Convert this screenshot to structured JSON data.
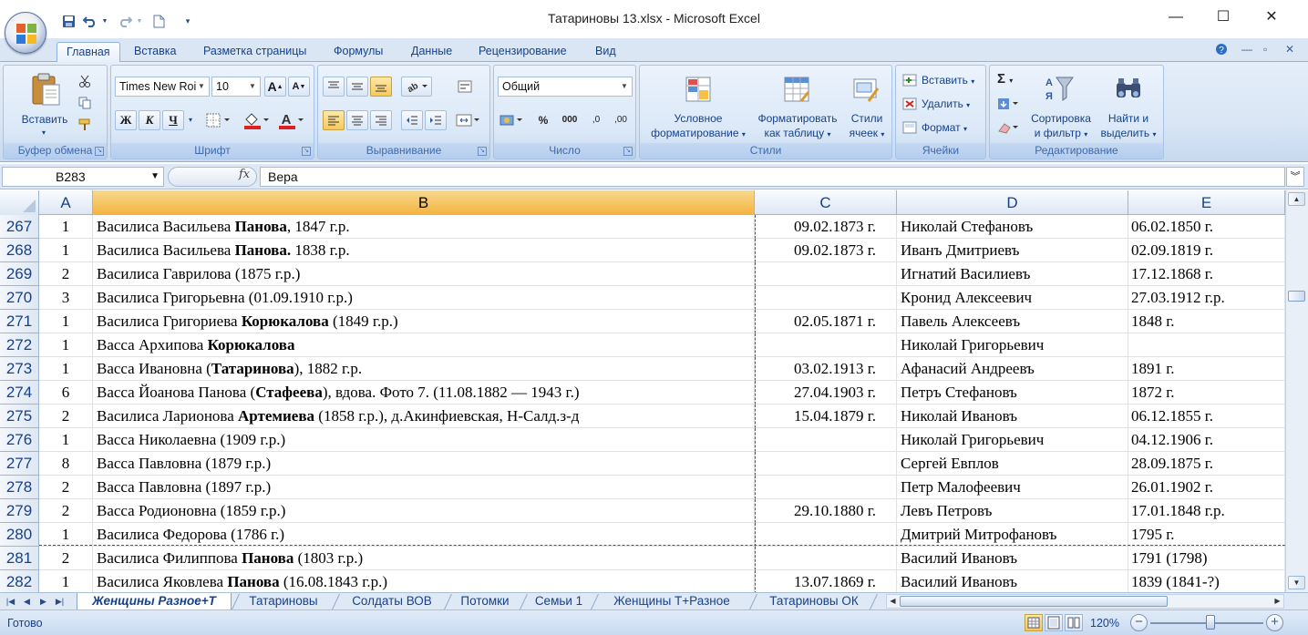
{
  "window": {
    "title": "Татариновы 13.xlsx - Microsoft Excel",
    "minimize": "—",
    "maximize": "☐",
    "close": "✕"
  },
  "qat": {
    "save_icon": "save-icon",
    "undo_icon": "undo-icon",
    "redo_icon": "redo-icon",
    "new_icon": "new-document-icon",
    "customize_icon": "customize-icon"
  },
  "ribbon_tabs": [
    {
      "label": "Главная",
      "active": true
    },
    {
      "label": "Вставка"
    },
    {
      "label": "Разметка страницы"
    },
    {
      "label": "Формулы"
    },
    {
      "label": "Данные"
    },
    {
      "label": "Рецензирование"
    },
    {
      "label": "Вид"
    }
  ],
  "ribbon": {
    "clipboard": {
      "label": "Буфер обмена",
      "paste": "Вставить"
    },
    "font": {
      "label": "Шрифт",
      "font_name": "Times New Roi",
      "font_size": "10",
      "bold": "Ж",
      "italic": "К",
      "underline": "Ч",
      "grow": "A",
      "shrink": "A"
    },
    "alignment": {
      "label": "Выравнивание"
    },
    "number": {
      "label": "Число",
      "format": "Общий",
      "percent": "%",
      "thousands": "000",
      "inc_dec": ",0",
      "dec_dec": ",00"
    },
    "styles": {
      "label": "Стили",
      "cond_format_1": "Условное",
      "cond_format_2": "форматирование",
      "format_table_1": "Форматировать",
      "format_table_2": "как таблицу",
      "cell_styles_1": "Стили",
      "cell_styles_2": "ячеек"
    },
    "cells": {
      "label": "Ячейки",
      "insert": "Вставить",
      "delete": "Удалить",
      "format": "Формат"
    },
    "editing": {
      "label": "Редактирование",
      "sum": "Σ",
      "sort_1": "Сортировка",
      "sort_2": "и фильтр",
      "find_1": "Найти и",
      "find_2": "выделить"
    }
  },
  "formula_bar": {
    "name_box": "B283",
    "fx": "fx",
    "value": "Вера"
  },
  "columns": [
    "A",
    "B",
    "C",
    "D",
    "E"
  ],
  "selected_column": "B",
  "rows": [
    {
      "n": "267",
      "a": "1",
      "b_pre": "Василиса Васильева ",
      "b_bold": "Панова",
      "b_post": ", 1847 г.р.",
      "c": "09.02.1873 г.",
      "d": "Николай Стефановъ",
      "e": "06.02.1850 г."
    },
    {
      "n": "268",
      "a": "1",
      "b_pre": "Василиса Васильева ",
      "b_bold": "Панова.",
      "b_post": " 1838 г.р.",
      "c": "09.02.1873 г.",
      "d": "Иванъ Дмитриевъ",
      "e": "02.09.1819 г."
    },
    {
      "n": "269",
      "a": "2",
      "b_pre": "Василиса Гаврилова (1875 г.р.)",
      "b_bold": "",
      "b_post": "",
      "c": "",
      "d": "Игнатий Василиевъ",
      "e": "17.12.1868 г."
    },
    {
      "n": "270",
      "a": "3",
      "b_pre": "Василиса Григорьевна (01.09.1910 г.р.)",
      "b_bold": "",
      "b_post": "",
      "c": "",
      "d": "Кронид Алексеевич",
      "e": "27.03.1912 г.р."
    },
    {
      "n": "271",
      "a": "1",
      "b_pre": "Василиса Григориева ",
      "b_bold": "Корюкалова",
      "b_post": " (1849 г.р.)",
      "c": "02.05.1871 г.",
      "d": "Павель Алексеевъ",
      "e": "1848 г."
    },
    {
      "n": "272",
      "a": "1",
      "b_pre": "Васса Архипова ",
      "b_bold": "Корюкалова",
      "b_post": "",
      "c": "",
      "d": "Николай Григорьевич",
      "e": ""
    },
    {
      "n": "273",
      "a": "1",
      "b_pre": "Васса Ивановна (",
      "b_bold": "Татаринова",
      "b_post": "), 1882 г.р.",
      "c": "03.02.1913 г.",
      "d": "Афанасий Андреевъ",
      "e": "1891 г."
    },
    {
      "n": "274",
      "a": "6",
      "b_pre": "Васса Йоанова Панова (",
      "b_bold": "Стафеева",
      "b_post": "), вдова. Фото 7.  (11.08.1882 — 1943 г.)",
      "c": "27.04.1903 г.",
      "d": "Петръ Стефановъ",
      "e": "1872 г."
    },
    {
      "n": "275",
      "a": "2",
      "b_pre": "Василиса Ларионова ",
      "b_bold": "Артемиева",
      "b_post": " (1858 г.р.), д.Акинфиевская, Н-Салд.з-д",
      "c": "15.04.1879 г.",
      "d": "Николай Ивановъ",
      "e": "06.12.1855 г."
    },
    {
      "n": "276",
      "a": "1",
      "b_pre": "Васса Николаевна (1909 г.р.)",
      "b_bold": "",
      "b_post": "",
      "c": "",
      "d": "Николай Григорьевич",
      "e": "04.12.1906 г."
    },
    {
      "n": "277",
      "a": "8",
      "b_pre": "Васса Павловна (1879 г.р.)",
      "b_bold": "",
      "b_post": "",
      "c": "",
      "d": "Сергей Евплов",
      "e": "28.09.1875 г."
    },
    {
      "n": "278",
      "a": "2",
      "b_pre": "Васса Павловна (1897 г.р.)",
      "b_bold": "",
      "b_post": "",
      "c": "",
      "d": "Петр Малофеевич",
      "e": "26.01.1902 г."
    },
    {
      "n": "279",
      "a": "2",
      "b_pre": "Васса Родионовна (1859 г.р.)",
      "b_bold": "",
      "b_post": "",
      "c": "29.10.1880 г.",
      "d": "Левъ Петровъ",
      "e": "17.01.1848 г.р."
    },
    {
      "n": "280",
      "a": "1",
      "b_pre": "Василиса Федорова (1786 г.)",
      "b_bold": "",
      "b_post": "",
      "c": "",
      "d": "Дмитрий Митрофановъ",
      "e": "1795 г."
    },
    {
      "n": "281",
      "a": "2",
      "b_pre": "Василиса Филиппова ",
      "b_bold": "Панова",
      "b_post": " (1803 г.р.)",
      "c": "",
      "d": "Василий Ивановъ",
      "e": "1791 (1798)"
    },
    {
      "n": "282",
      "a": "1",
      "b_pre": "Василиса Яковлева ",
      "b_bold": "Панова",
      "b_post": " (16.08.1843 г.р.)",
      "c": "13.07.1869 г.",
      "d": "Василий Ивановъ",
      "e": "1839 (1841-?)"
    }
  ],
  "sheet_tabs": [
    {
      "label": "Женщины Разное+Т",
      "active": true
    },
    {
      "label": "Татариновы"
    },
    {
      "label": "Солдаты ВОВ"
    },
    {
      "label": "Потомки"
    },
    {
      "label": "Семьи 1"
    },
    {
      "label": "Женщины Т+Разное"
    },
    {
      "label": "Татариновы ОК"
    }
  ],
  "status": {
    "text": "Готово",
    "zoom": "120%",
    "zoom_level_percent": 120,
    "zoom_minus": "−",
    "zoom_plus": "+"
  },
  "colors": {
    "accent": "#15428b",
    "ribbon_bg": "#dbe6f4",
    "selected_header": "#f3b33e"
  }
}
